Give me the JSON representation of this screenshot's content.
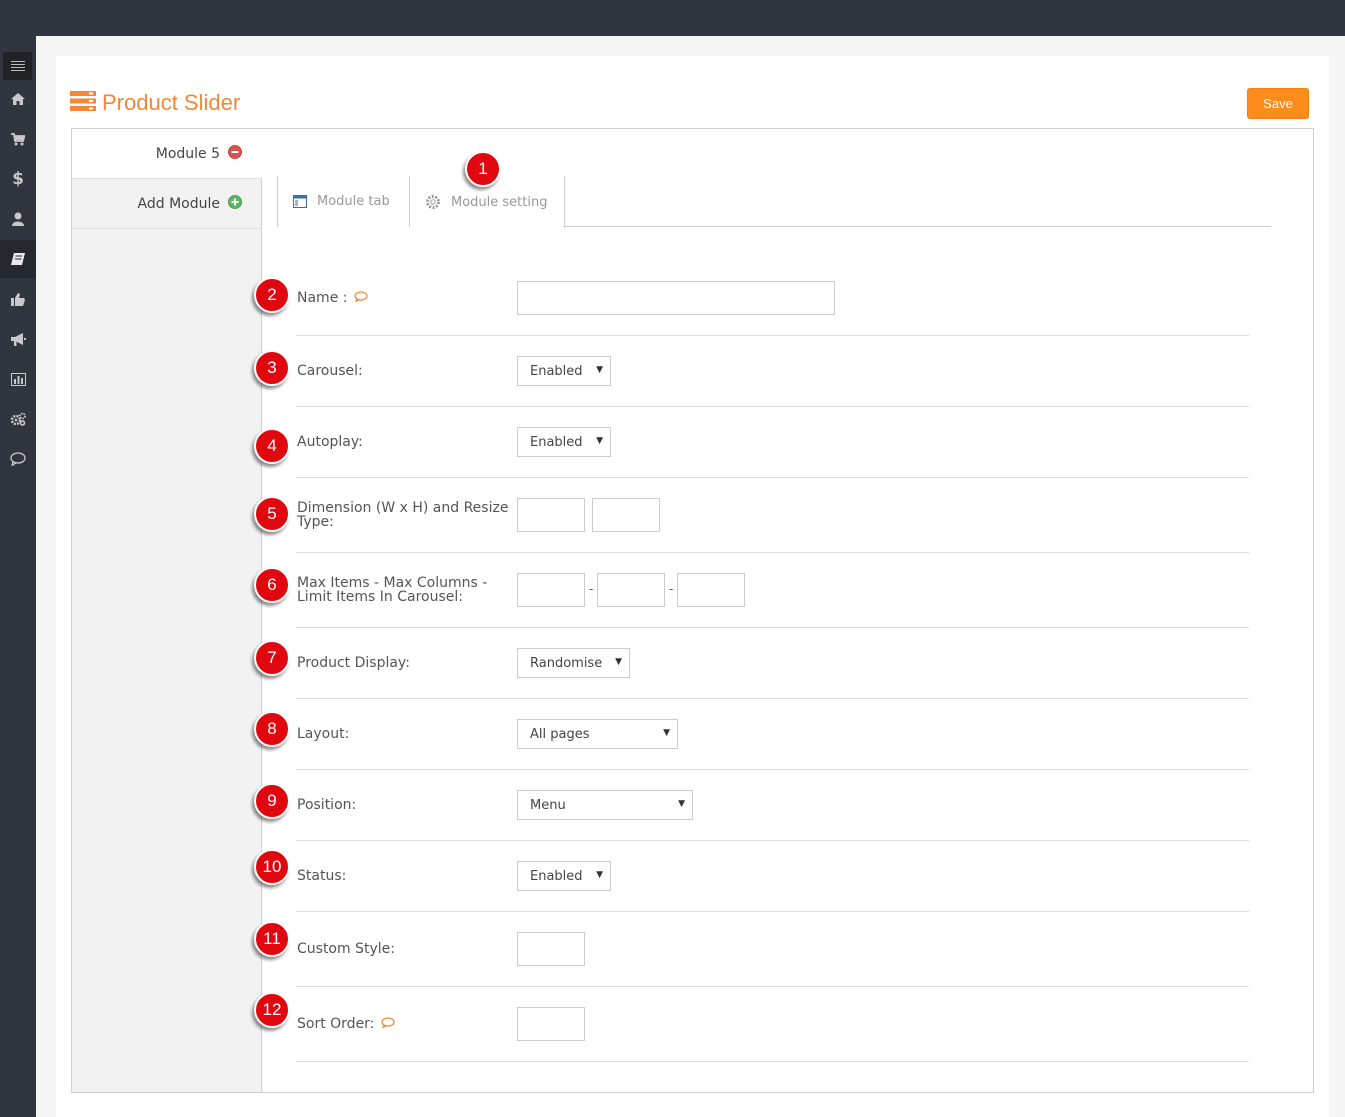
{
  "sidebar": {
    "toggle_icon": "hamburger-icon",
    "items": [
      {
        "icon": "home-icon"
      },
      {
        "icon": "cart-icon"
      },
      {
        "icon": "dollar-icon"
      },
      {
        "icon": "user-icon"
      },
      {
        "icon": "book-icon",
        "active": true
      },
      {
        "icon": "thumbs-up-icon"
      },
      {
        "icon": "megaphone-icon"
      },
      {
        "icon": "bar-chart-icon"
      },
      {
        "icon": "gears-icon"
      },
      {
        "icon": "chat-icon"
      }
    ]
  },
  "header": {
    "title": "Product Slider",
    "save_label": "Save",
    "accent": "#f38733",
    "save_color": "#fe8c1a"
  },
  "modules": {
    "items": [
      {
        "label": "Module 5",
        "icon": "remove-icon"
      },
      {
        "label": "Add Module",
        "icon": "add-icon"
      }
    ]
  },
  "tabs": {
    "module_tab": "Module tab",
    "module_setting": "Module setting"
  },
  "badges": [
    "1",
    "2",
    "3",
    "4",
    "5",
    "6",
    "7",
    "8",
    "9",
    "10",
    "11",
    "12"
  ],
  "form": {
    "name_label": "Name :",
    "carousel_label": "Carousel:",
    "carousel_value": "Enabled",
    "autoplay_label": "Autoplay:",
    "autoplay_value": "Enabled",
    "dimension_label_1": "Dimension (W x H) and Resize",
    "dimension_label_2": "Type:",
    "maxitems_label_1": "Max Items - Max Columns -",
    "maxitems_label_2": "Limit Items In Carousel:",
    "dash": "-",
    "product_display_label": "Product Display:",
    "product_display_value": "Randomise",
    "layout_label": "Layout:",
    "layout_value": "All pages",
    "position_label": "Position:",
    "position_value": "Menu",
    "status_label": "Status:",
    "status_value": "Enabled",
    "custom_style_label": "Custom Style:",
    "sort_order_label": "Sort Order:"
  },
  "colors": {
    "badge": "#e0080e",
    "dark": "#31353d"
  }
}
